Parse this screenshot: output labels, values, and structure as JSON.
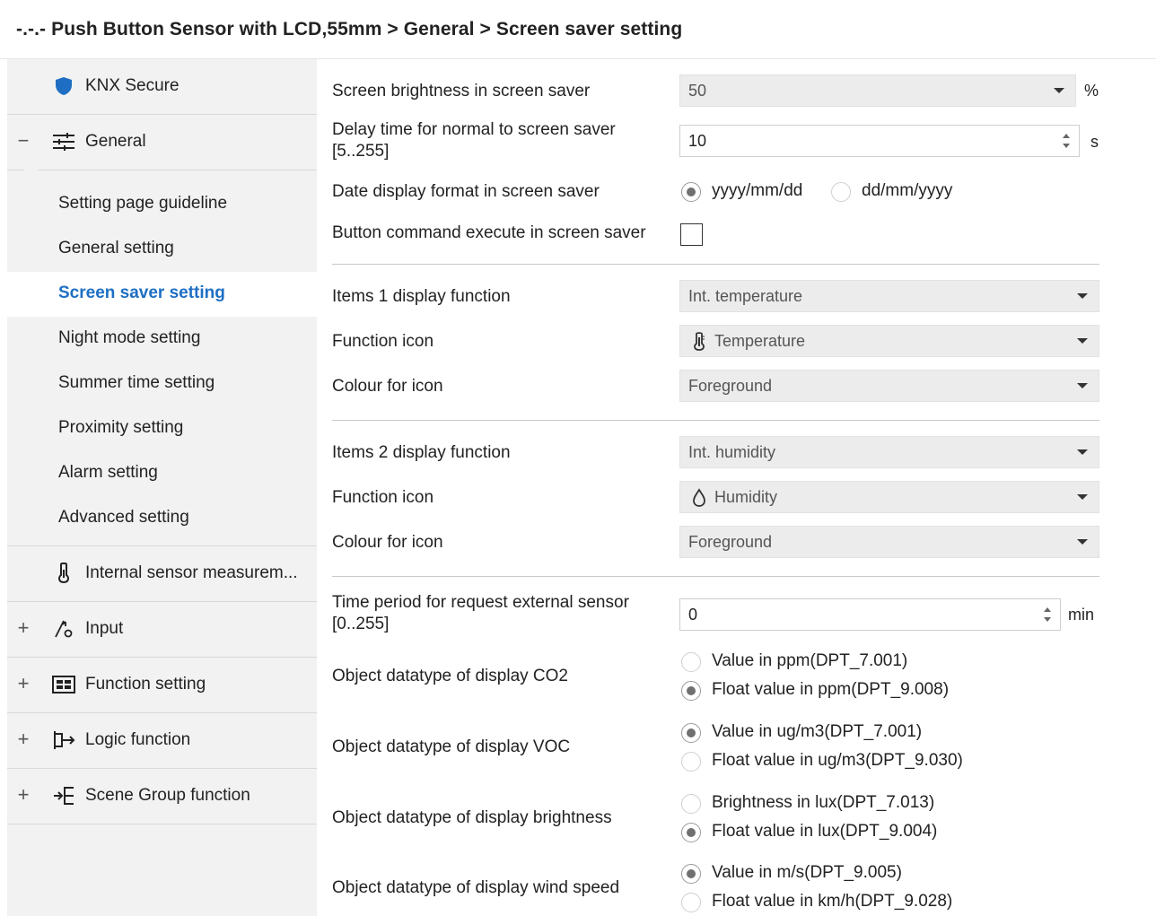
{
  "breadcrumb": "-.-.- Push Button Sensor with LCD,55mm > General > Screen saver setting",
  "sidebar": {
    "items": [
      {
        "label": "KNX Secure",
        "icon": "shield-icon",
        "expander": ""
      },
      {
        "label": "General",
        "icon": "sliders-icon",
        "expander": "−"
      },
      {
        "label": "Internal sensor measurem...",
        "icon": "thermometer-icon",
        "expander": ""
      },
      {
        "label": "Input",
        "icon": "input-icon",
        "expander": "+"
      },
      {
        "label": "Function setting",
        "icon": "function-icon",
        "expander": "+"
      },
      {
        "label": "Logic function",
        "icon": "logic-icon",
        "expander": "+"
      },
      {
        "label": "Scene Group function",
        "icon": "scene-icon",
        "expander": "+"
      }
    ],
    "sub_items": [
      {
        "label": "Setting page guideline"
      },
      {
        "label": "General setting"
      },
      {
        "label": "Screen saver setting"
      },
      {
        "label": "Night mode setting"
      },
      {
        "label": "Summer time setting"
      },
      {
        "label": "Proximity setting"
      },
      {
        "label": "Alarm setting"
      },
      {
        "label": "Advanced setting"
      }
    ]
  },
  "form": {
    "brightness": {
      "label": "Screen brightness in screen saver",
      "value": "50",
      "unit": "%"
    },
    "delay": {
      "label_line1": "Delay time for normal to screen saver",
      "label_line2": "[5..255]",
      "value": "10",
      "unit": "s"
    },
    "date_format": {
      "label": "Date display format in screen saver",
      "options": [
        "yyyy/mm/dd",
        "dd/mm/yyyy"
      ],
      "selected": 0
    },
    "button_cmd": {
      "label": "Button command execute in screen saver",
      "checked": false
    },
    "item1": {
      "display_label": "Items 1 display function",
      "display_value": "Int. temperature",
      "icon_label": "Function icon",
      "icon_value": "Temperature",
      "icon_name": "thermometer-icon",
      "colour_label": "Colour for icon",
      "colour_value": "Foreground"
    },
    "item2": {
      "display_label": "Items 2 display function",
      "display_value": "Int. humidity",
      "icon_label": "Function icon",
      "icon_value": "Humidity",
      "icon_name": "droplet-icon",
      "colour_label": "Colour for icon",
      "colour_value": "Foreground"
    },
    "period": {
      "label_line1": "Time period for request external sensor",
      "label_line2": "[0..255]",
      "value": "0",
      "unit": "min"
    },
    "co2": {
      "label": "Object datatype of display CO2",
      "options": [
        "Value in ppm(DPT_7.001)",
        "Float value in ppm(DPT_9.008)"
      ],
      "selected": 1
    },
    "voc": {
      "label": "Object datatype of display VOC",
      "options": [
        "Value in ug/m3(DPT_7.001)",
        "Float value in ug/m3(DPT_9.030)"
      ],
      "selected": 0
    },
    "brightness_type": {
      "label": "Object datatype of display brightness",
      "options": [
        "Brightness in lux(DPT_7.013)",
        "Float value in lux(DPT_9.004)"
      ],
      "selected": 1
    },
    "wind": {
      "label": "Object datatype of display wind speed",
      "options": [
        "Value in m/s(DPT_9.005)",
        "Float value in km/h(DPT_9.028)"
      ],
      "selected": 0
    }
  },
  "colors": {
    "accent": "#1e6fc4",
    "sidebar_bg": "#f2f2f2",
    "select_bg": "#ececec"
  }
}
